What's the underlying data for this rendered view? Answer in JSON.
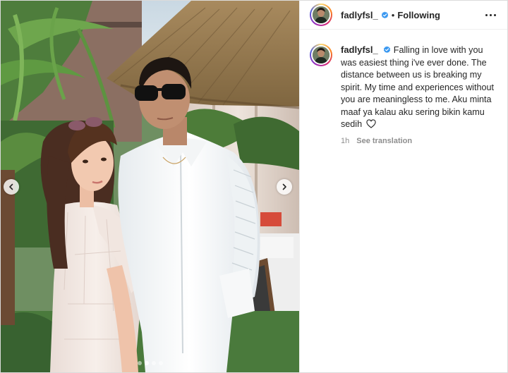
{
  "post": {
    "author": {
      "username": "fadlyfsl_",
      "follow_status": "Following",
      "separator": "•"
    },
    "caption": {
      "text": "Falling in love with you was easiest thing i've ever done. The distance between us is breaking my spirit. My time and experiences without you are meaningless to me. Aku minta maaf ya kalau aku sering bikin kamu sedih"
    },
    "meta": {
      "time_ago": "1h",
      "translate_label": "See translation"
    },
    "carousel": {
      "slide_count": 4,
      "active_index": 1
    }
  },
  "colors": {
    "verified_badge": "#3897f0",
    "text_primary": "#262626",
    "text_secondary": "#8e8e8e"
  },
  "icons": [
    "verified-badge-icon",
    "more-options-icon",
    "chevron-left-icon",
    "chevron-right-icon",
    "heart-outline-icon"
  ]
}
